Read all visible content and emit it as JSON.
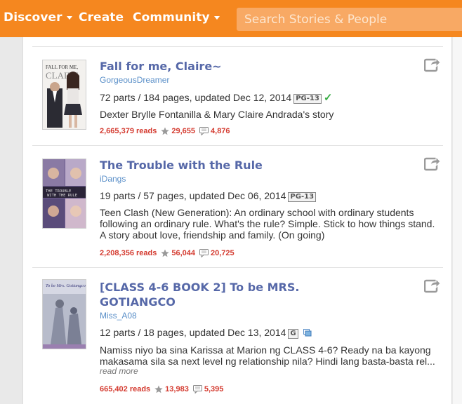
{
  "nav": {
    "discover": "Discover",
    "create": "Create",
    "community": "Community",
    "search_placeholder": "Search Stories & People"
  },
  "stories": [
    {
      "title": "Fall for me, Claire~",
      "author": "GorgeousDreamer",
      "meta": "72 parts / 184 pages, updated Dec 12, 2014",
      "rating": "PG-13",
      "description": "Dexter Brylle Fontanilla & Mary Claire Andrada's story",
      "reads": "2,665,379 reads",
      "votes": "29,655",
      "comments": "4,876",
      "cover_text": "FALL FOR ME, CLAIRE"
    },
    {
      "title": "The Trouble with the Rule",
      "author": "iDangs",
      "meta": "19 parts / 57 pages, updated Dec 06, 2014",
      "rating": "PG-13",
      "description": "Teen Clash (New Generation): An ordinary school with ordinary students following an ordinary rule. What's the rule? Simple. Stick to how things stand. A story about love, friendship and family. (On going)",
      "reads": "2,208,356 reads",
      "votes": "56,044",
      "comments": "20,725",
      "cover_text": "THE TROUBLE WITH THE RULE"
    },
    {
      "title": "[CLASS 4-6 BOOK 2] To be MRS. GOTIANGCO",
      "author": "Miss_A08",
      "meta": "12 parts / 18 pages, updated Dec 13, 2014",
      "rating": "G",
      "description": "Namiss niyo ba sina Karissa at Marion ng CLASS 4-6? Ready na ba kayong makasama sila sa next level ng relationship nila? Hindi lang basta-basta rel...",
      "read_more": "read more",
      "reads": "665,402 reads",
      "votes": "13,983",
      "comments": "5,395",
      "cover_text": "To be Mrs. Gotiangco"
    }
  ],
  "colors": {
    "nav_orange": "#f5871f",
    "title_blue": "#5668a8",
    "stat_red": "#d43a2f"
  },
  "icons": [
    "chevron-down-icon",
    "star-icon",
    "comment-icon",
    "share-icon",
    "check-icon"
  ]
}
